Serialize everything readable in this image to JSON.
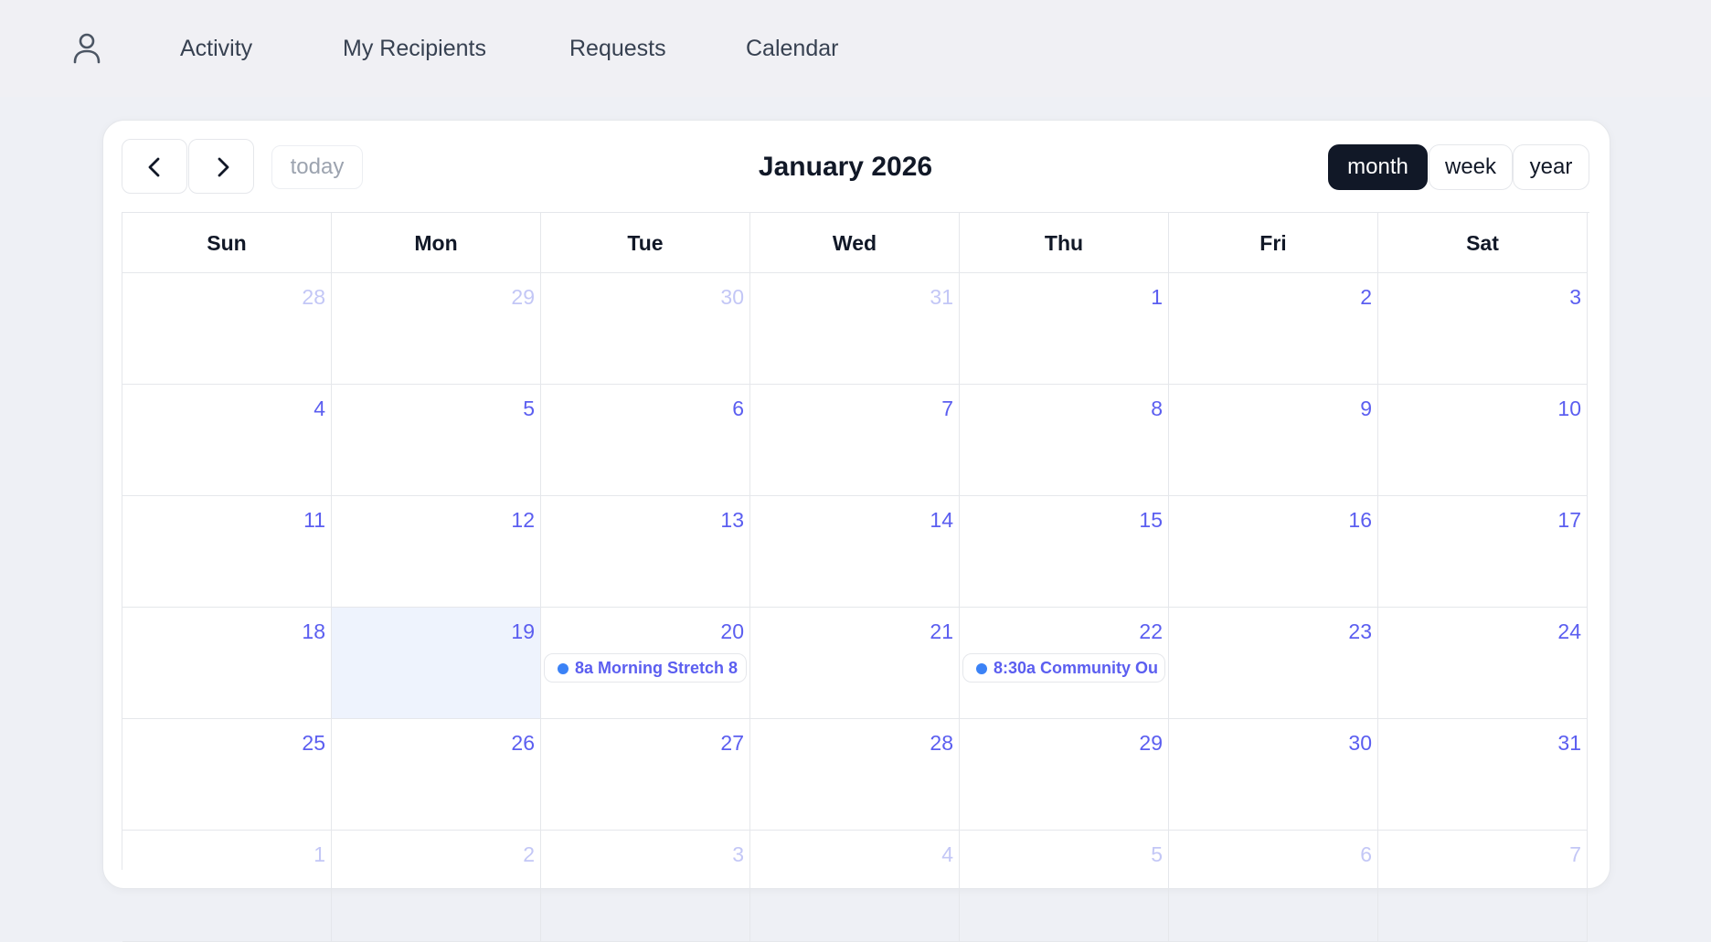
{
  "nav": {
    "items": [
      "Activity",
      "My Recipients",
      "Requests",
      "Calendar"
    ]
  },
  "toolbar": {
    "today_label": "today",
    "title": "January 2026",
    "views": [
      "month",
      "week",
      "year"
    ],
    "active_view": "month"
  },
  "calendar": {
    "weekdays": [
      "Sun",
      "Mon",
      "Tue",
      "Wed",
      "Thu",
      "Fri",
      "Sat"
    ],
    "today": "19",
    "weeks": [
      [
        "28",
        "29",
        "30",
        "31",
        "1",
        "2",
        "3"
      ],
      [
        "4",
        "5",
        "6",
        "7",
        "8",
        "9",
        "10"
      ],
      [
        "11",
        "12",
        "13",
        "14",
        "15",
        "16",
        "17"
      ],
      [
        "18",
        "19",
        "20",
        "21",
        "22",
        "23",
        "24"
      ],
      [
        "25",
        "26",
        "27",
        "28",
        "29",
        "30",
        "31"
      ],
      [
        "1",
        "2",
        "3",
        "4",
        "5",
        "6",
        "7"
      ]
    ],
    "other_month_weeks": {
      "0": [
        0,
        1,
        2,
        3
      ],
      "5": [
        0,
        1,
        2,
        3,
        4,
        5,
        6
      ]
    },
    "events": [
      {
        "week": 3,
        "day": 2,
        "label": "8a Morning Stretch 8"
      },
      {
        "week": 3,
        "day": 4,
        "label": "8:30a Community Ou"
      }
    ]
  },
  "colors": {
    "accent": "#5b5ef0",
    "event_dot": "#3b82f6",
    "today_bg": "#eef3fd",
    "active_btn": "#111827"
  },
  "icons": {
    "user": "user-icon",
    "prev": "chevron-left-icon",
    "next": "chevron-right-icon"
  }
}
